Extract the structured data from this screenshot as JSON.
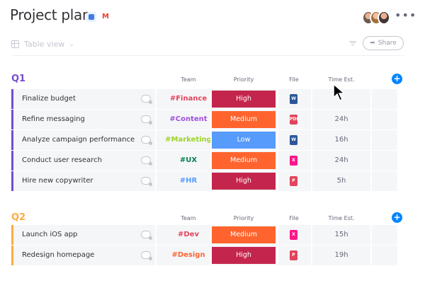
{
  "header": {
    "title": "Project plan",
    "icons": [
      "board-icon",
      "gmail-icon"
    ],
    "more_label": "•••"
  },
  "toolbar": {
    "view_label": "Table view",
    "share_label": "Share"
  },
  "columns": {
    "team": "Team",
    "priority": "Priority",
    "file": "File",
    "time": "Time Est."
  },
  "colors": {
    "group_q1": "#784bd1",
    "group_q2": "#fdab3d",
    "high": "#c4254c",
    "medium": "#ff642e",
    "low": "#579bfc",
    "add": "#0085ff"
  },
  "groups": [
    {
      "title": "Q1",
      "rows": [
        {
          "name": "Finalize budget",
          "team": "#Finance",
          "team_color": "#e2445c",
          "priority": "High",
          "file": "W",
          "file_color": "#2b579a",
          "time": ""
        },
        {
          "name": "Refine messaging",
          "team": "#Content",
          "team_color": "#9d50dd",
          "priority": "Medium",
          "file": "PDF",
          "file_color": "#e2445c",
          "time": "24h"
        },
        {
          "name": "Analyze campaign performance",
          "team": "#Marketing",
          "team_color": "#9cd326",
          "priority": "Low",
          "file": "W",
          "file_color": "#2b579a",
          "time": "16h"
        },
        {
          "name": "Conduct user research",
          "team": "#UX",
          "team_color": "#037f4c",
          "priority": "Medium",
          "file": "X",
          "file_color": "#ff158a",
          "time": "24h"
        },
        {
          "name": "Hire new copywriter",
          "team": "#HR",
          "team_color": "#579bfc",
          "priority": "High",
          "file": "P",
          "file_color": "#e2445c",
          "time": "5h"
        }
      ]
    },
    {
      "title": "Q2",
      "rows": [
        {
          "name": "Launch iOS app",
          "team": "#Dev",
          "team_color": "#e2445c",
          "priority": "Medium",
          "file": "X",
          "file_color": "#ff158a",
          "time": "15h"
        },
        {
          "name": "Redesign homepage",
          "team": "#Design",
          "team_color": "#ff642e",
          "priority": "High",
          "file": "P",
          "file_color": "#e2445c",
          "time": "19h"
        }
      ]
    }
  ]
}
